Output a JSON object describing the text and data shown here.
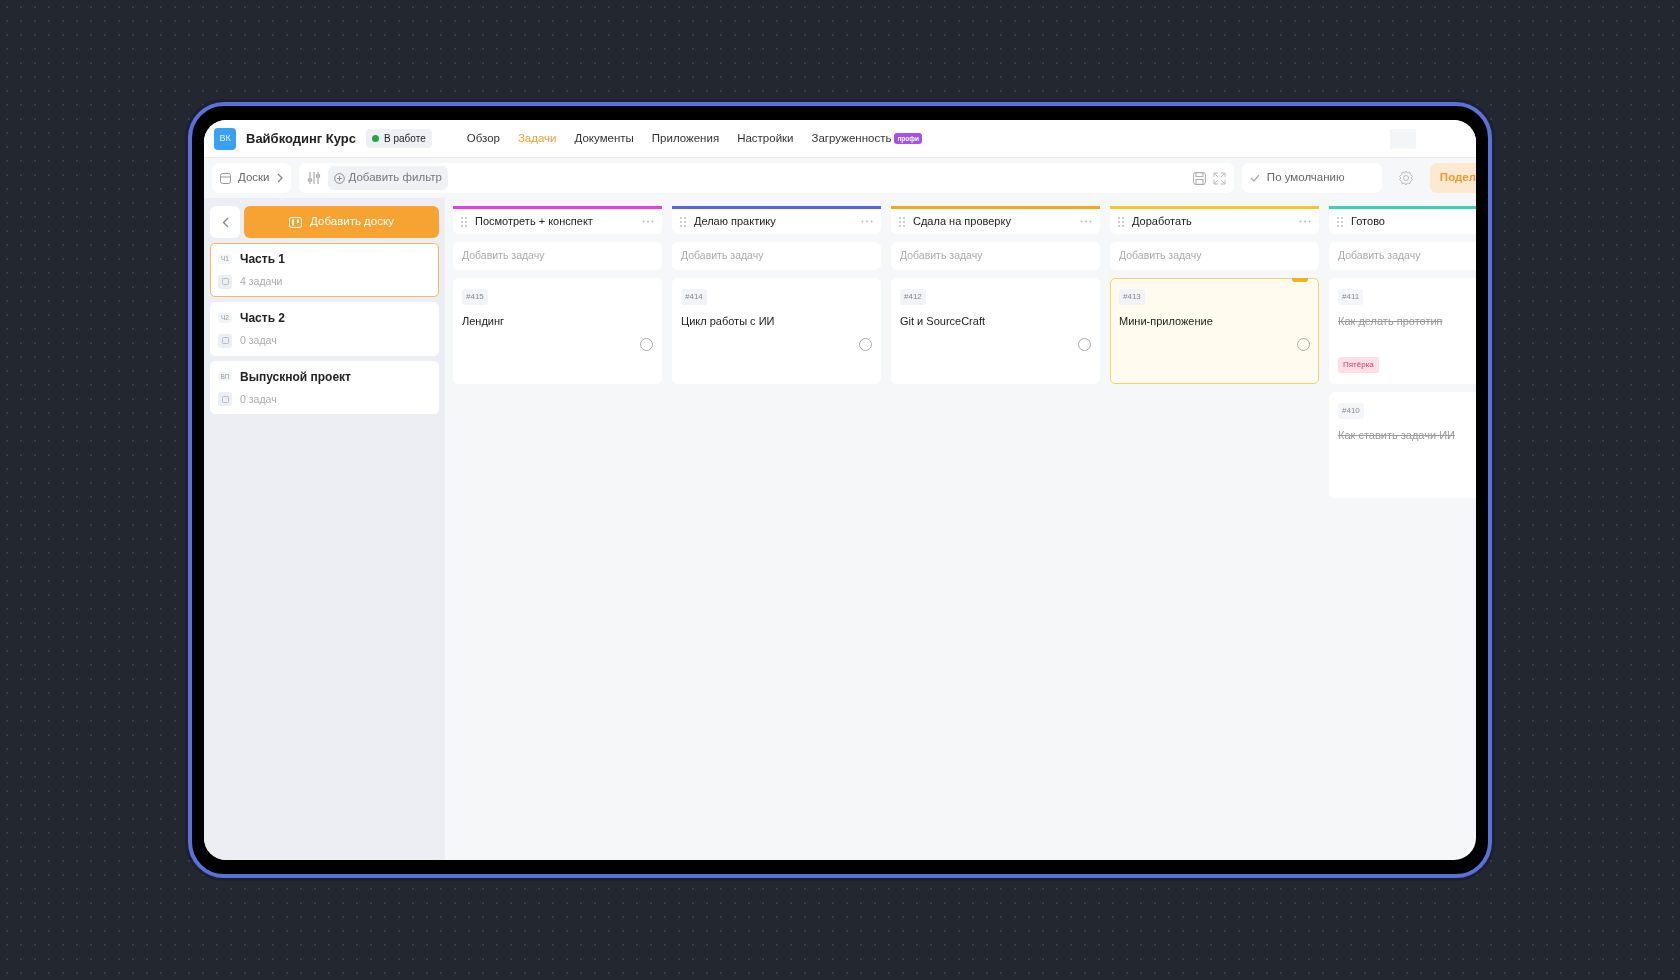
{
  "project": {
    "logo": "ВК",
    "title": "Вайбкодинг Курс",
    "status": "В работе"
  },
  "tabs": [
    {
      "label": "Обзор",
      "selected": false
    },
    {
      "label": "Задачи",
      "selected": true
    },
    {
      "label": "Документы",
      "selected": false
    },
    {
      "label": "Приложения",
      "selected": false
    },
    {
      "label": "Настройки",
      "selected": false
    },
    {
      "label": "Загруженность",
      "selected": false,
      "badge": "профи"
    }
  ],
  "toolbar": {
    "boards": "Доски",
    "add_filter": "Добавить фильтр",
    "view": "По умолчанию",
    "share": "Подел"
  },
  "sidebar": {
    "add_button": "Добавить доску",
    "boards": [
      {
        "abbr": "Ч1",
        "name": "Часть 1",
        "count": "4 задачи",
        "selected": true
      },
      {
        "abbr": "Ч2",
        "name": "Часть 2",
        "count": "0 задач",
        "selected": false
      },
      {
        "abbr": "ВП",
        "name": "Выпускной проект",
        "count": "0 задач",
        "selected": false
      }
    ]
  },
  "columns": [
    {
      "title": "Посмотреть + конспект",
      "color": "#e040e8",
      "placeholder": "Добавить задачу",
      "cards": [
        {
          "id": "#415",
          "title": "Лендинг",
          "done": false,
          "highlighted": false
        }
      ]
    },
    {
      "title": "Делаю практику",
      "color": "#5b63e0",
      "placeholder": "Добавить задачу",
      "cards": [
        {
          "id": "#414",
          "title": "Цикл работы с ИИ",
          "done": false,
          "highlighted": false
        }
      ]
    },
    {
      "title": "Сдала на проверку",
      "color": "#f5a623",
      "placeholder": "Добавить задачу",
      "cards": [
        {
          "id": "#412",
          "title": "Git и SourceCraft",
          "done": false,
          "highlighted": false
        }
      ]
    },
    {
      "title": "Доработать",
      "color": "#f5c431",
      "placeholder": "Добавить задачу",
      "cards": [
        {
          "id": "#413",
          "title": "Мини-приложение",
          "done": false,
          "highlighted": true
        }
      ]
    },
    {
      "title": "Готово",
      "color": "#3ecfb8",
      "placeholder": "Добавить задачу",
      "cards": [
        {
          "id": "#411",
          "title": "Как делать прототип",
          "done": true,
          "highlighted": false,
          "tag": "Пятёрка"
        },
        {
          "id": "#410",
          "title": "Как ставить задачи ИИ",
          "done": true,
          "highlighted": false
        }
      ]
    }
  ]
}
